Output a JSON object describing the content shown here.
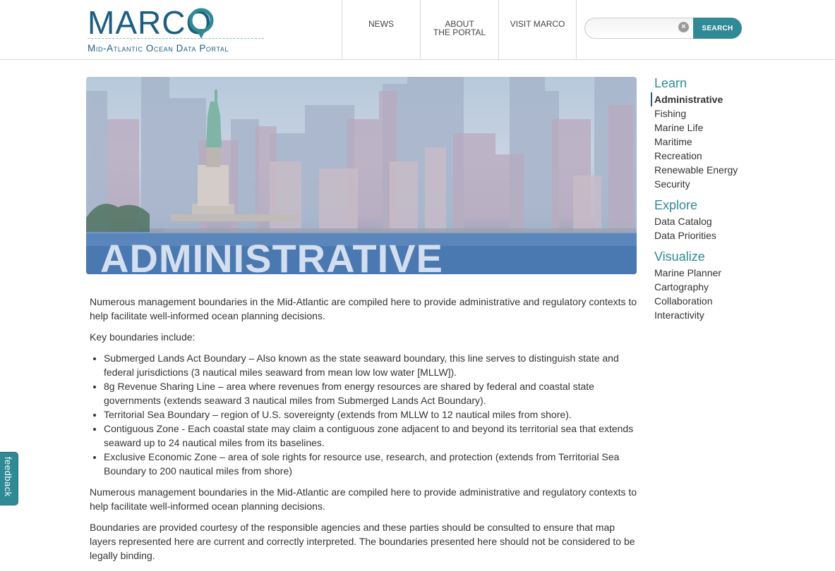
{
  "header": {
    "logo_word": "MARCO",
    "logo_subtitle": "Mid-Atlantic Ocean Data Portal",
    "nav": [
      {
        "label": "NEWS"
      },
      {
        "label_line1": "ABOUT",
        "label_line2": "THE PORTAL"
      },
      {
        "label": "VISIT MARCO"
      }
    ],
    "search": {
      "placeholder": "",
      "clear_icon": "×",
      "button_label": "SEARCH"
    }
  },
  "hero": {
    "title": "ADMINISTRATIVE"
  },
  "content": {
    "intro": "Numerous management boundaries in the Mid-Atlantic are compiled here to provide administrative and regulatory contexts to help facilitate well-informed ocean planning decisions.",
    "key_label": "Key boundaries include:",
    "boundaries": [
      "Submerged Lands Act Boundary – Also known as the state seaward boundary, this line serves to distinguish state and federal jurisdictions (3 nautical miles seaward from mean low low water [MLLW]).",
      "8g Revenue Sharing Line – area where revenues from energy resources are shared by federal and coastal state governments (extends seaward 3 nautical miles from Submerged Lands Act Boundary).",
      "Territorial Sea Boundary – region of U.S. sovereignty (extends from MLLW to 12 nautical miles from shore).",
      "Contiguous Zone - Each coastal state may claim a contiguous zone adjacent to and beyond its territorial sea that extends seaward up to 24 nautical miles from its baselines.",
      "Exclusive Economic Zone – area of sole rights for resource use, research, and protection (extends from Territorial Sea Boundary to 200 nautical miles from shore)"
    ],
    "repeat": "Numerous management boundaries in the Mid-Atlantic are compiled here to provide administrative and regulatory contexts to help facilitate well-informed ocean planning decisions.",
    "disclaimer": "Boundaries are provided courtesy of the responsible agencies and these parties should be consulted to ensure that map layers represented here are current and correctly interpreted. The boundaries presented here should not be considered to be legally binding."
  },
  "sidebar": {
    "learn": {
      "heading": "Learn",
      "items": [
        "Administrative",
        "Fishing",
        "Marine Life",
        "Maritime",
        "Recreation",
        "Renewable Energy",
        "Security"
      ]
    },
    "explore": {
      "heading": "Explore",
      "items": [
        "Data Catalog",
        "Data Priorities"
      ]
    },
    "visualize": {
      "heading": "Visualize",
      "items": [
        "Marine Planner",
        "Cartography",
        "Collaboration",
        "Interactivity"
      ]
    }
  },
  "feedback": {
    "label": "feedback"
  },
  "colors": {
    "brand": "#1b5e82",
    "accent": "#2f8a95"
  }
}
